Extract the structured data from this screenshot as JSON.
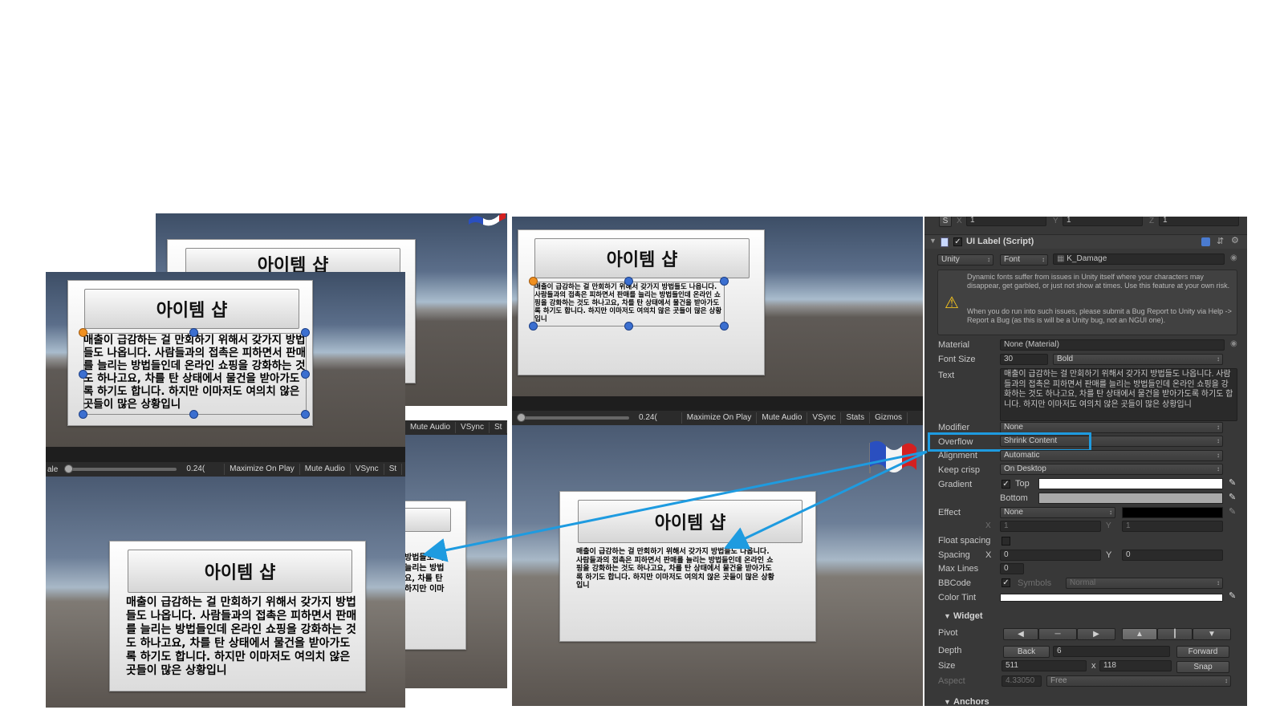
{
  "panel_title": "아이템 샵",
  "panel_body": "매출이 급감하는 걸 만회하기 위해서 갖가지 방법들도 나옵니다. 사람들과의 접촉은 피하면서 판매를 늘리는 방법들인데 온라인 쇼핑을 강화하는 것도 하나고요, 차를 탄 상태에서 물건을 받아가도록 하기도 합니다. 하지만 이마저도 여의치 않은 곳들이 많은 상황입니",
  "left_partial_text": "방법들도 나\n늘리는 방법\n요, 차를 탄\n하지만 이마",
  "toolbar_left": {
    "scale_label": "ale",
    "value": "0.24(",
    "items": [
      "Maximize On Play",
      "Mute Audio",
      "VSync",
      "St"
    ]
  },
  "toolbar_mid": {
    "items": [
      "Mute Audio",
      "VSync",
      "St"
    ]
  },
  "toolbar_right": {
    "value": "0.24(",
    "items": [
      "Maximize On Play",
      "Mute Audio",
      "VSync",
      "Stats",
      "Gizmos"
    ]
  },
  "inspector": {
    "scale_header": {
      "s": "S",
      "x_label": "X",
      "x": "1",
      "y_label": "Y",
      "y": "1",
      "z_label": "Z",
      "z": "1"
    },
    "component_title": "UI Label (Script)",
    "font_type": "Unity",
    "font_button": "Font",
    "font_name": "K_Damage",
    "warning_1": "Dynamic fonts suffer from issues in Unity itself where your characters may disappear, get garbled, or just not show at times. Use this feature at your own risk.",
    "warning_2": "When you do run into such issues, please submit a Bug Report to Unity via Help -> Report a Bug (as this is will be a Unity bug, not an NGUI one).",
    "material_label": "Material",
    "material_value": "None (Material)",
    "font_size_label": "Font Size",
    "font_size_value": "30",
    "font_style": "Bold",
    "text_label": "Text",
    "text_value": "매출이 급감하는 걸 만회하기 위해서 갖가지 방법들도 나옵니다. 사람들과의 접촉은 피하면서 판매를 늘리는 방법들인데 온라인 쇼핑을 강화하는 것도 하나고요, 차를 탄 상태에서 물건을 받아가도록 하기도 합니다. 하지만 이마저도 여의치 않은 곳들이 많은 상황입니",
    "modifier_label": "Modifier",
    "modifier_value": "None",
    "overflow_label": "Overflow",
    "overflow_value": "Shrink Content",
    "alignment_label": "Alignment",
    "alignment_value": "Automatic",
    "keep_crisp_label": "Keep crisp",
    "keep_crisp_value": "On Desktop",
    "gradient_label": "Gradient",
    "gradient_top_label": "Top",
    "gradient_bottom_label": "Bottom",
    "effect_label": "Effect",
    "effect_value": "None",
    "effect_x_label": "X",
    "effect_x": "1",
    "effect_y_label": "Y",
    "effect_y": "1",
    "float_spacing_label": "Float spacing",
    "spacing_label": "Spacing",
    "spacing_x_label": "X",
    "spacing_x": "0",
    "spacing_y_label": "Y",
    "spacing_y": "0",
    "max_lines_label": "Max Lines",
    "max_lines_value": "0",
    "bbcode_label": "BBCode",
    "symbols_label": "Symbols",
    "symbols_value": "Normal",
    "color_tint_label": "Color Tint",
    "widget_header": "Widget",
    "pivot_label": "Pivot",
    "depth_label": "Depth",
    "depth_back": "Back",
    "depth_value": "6",
    "depth_forward": "Forward",
    "size_label": "Size",
    "size_w": "511",
    "size_x": "x",
    "size_h": "118",
    "size_snap": "Snap",
    "aspect_label": "Aspect",
    "aspect_value": "4.33050",
    "aspect_mode": "Free",
    "anchors_header": "Anchors"
  },
  "colors": {
    "highlight_box": "#1e9be0",
    "arrow": "#1e9be0",
    "inspector_bg": "#383838"
  }
}
